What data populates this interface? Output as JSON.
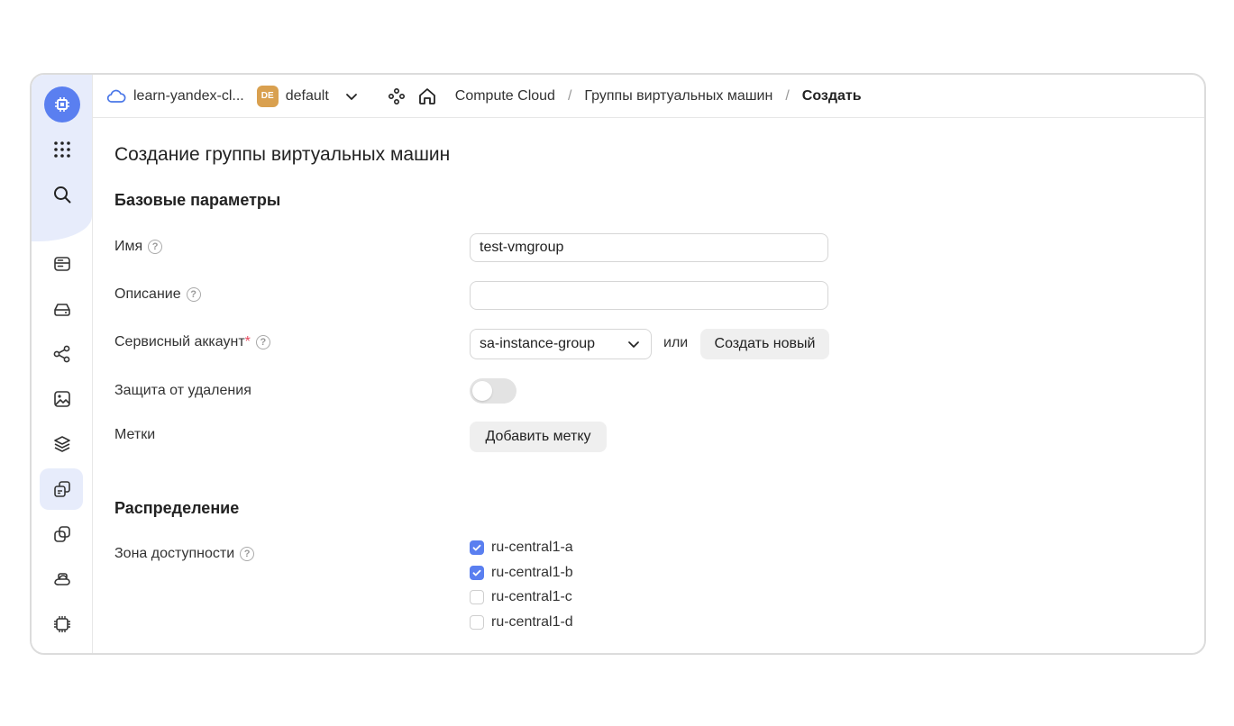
{
  "header": {
    "cloud_name": "learn-yandex-cl...",
    "folder_badge": "DE",
    "folder_name": "default",
    "breadcrumbs": [
      "Compute Cloud",
      "Группы виртуальных машин",
      "Создать"
    ],
    "separator": "/"
  },
  "page": {
    "title": "Создание группы виртуальных машин"
  },
  "basic": {
    "section_title": "Базовые параметры",
    "name_label": "Имя",
    "name_value": "test-vmgroup",
    "description_label": "Описание",
    "description_value": "",
    "service_account_label": "Сервисный аккаунт",
    "required_mark": "*",
    "service_account_value": "sa-instance-group",
    "or_text": "или",
    "create_new_label": "Создать новый",
    "deletion_protection_label": "Защита от удаления",
    "deletion_protection_on": false,
    "labels_label": "Метки",
    "add_label_button": "Добавить метку"
  },
  "distribution": {
    "section_title": "Распределение",
    "zone_label": "Зона доступности",
    "zones": [
      {
        "name": "ru-central1-a",
        "checked": true
      },
      {
        "name": "ru-central1-b",
        "checked": true
      },
      {
        "name": "ru-central1-c",
        "checked": false
      },
      {
        "name": "ru-central1-d",
        "checked": false
      }
    ]
  },
  "help_glyph": "?",
  "colors": {
    "accent": "#5a7ff0",
    "sidebar_highlight": "#e7ecfb",
    "folder_badge": "#d9a04f",
    "required": "#e84a5f"
  },
  "icons": {
    "sidebar": [
      "compute-logo-icon",
      "services-grid-icon",
      "search-icon",
      "instances-icon",
      "disks-icon",
      "network-icon",
      "images-icon",
      "layers-icon",
      "instance-groups-icon",
      "placement-groups-icon",
      "dedicated-hosts-icon",
      "gpu-icon"
    ],
    "header": [
      "cloud-icon",
      "chevron-down-icon",
      "resources-icon",
      "home-icon"
    ]
  }
}
